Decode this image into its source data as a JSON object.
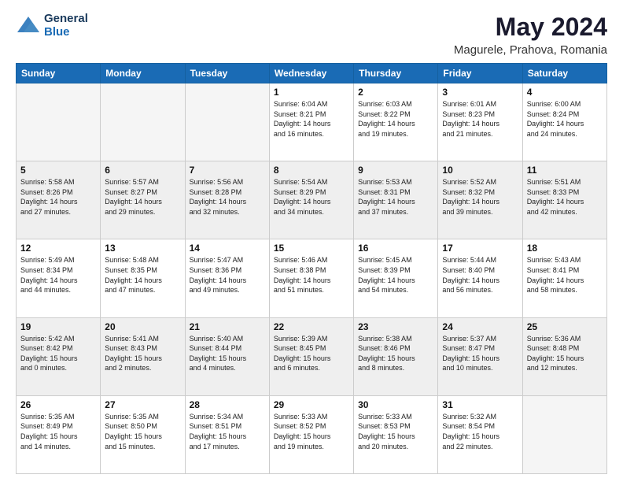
{
  "header": {
    "logo_line1": "General",
    "logo_line2": "Blue",
    "month": "May 2024",
    "location": "Magurele, Prahova, Romania"
  },
  "weekdays": [
    "Sunday",
    "Monday",
    "Tuesday",
    "Wednesday",
    "Thursday",
    "Friday",
    "Saturday"
  ],
  "weeks": [
    [
      {
        "day": "",
        "info": "",
        "empty": true
      },
      {
        "day": "",
        "info": "",
        "empty": true
      },
      {
        "day": "",
        "info": "",
        "empty": true
      },
      {
        "day": "1",
        "info": "Sunrise: 6:04 AM\nSunset: 8:21 PM\nDaylight: 14 hours\nand 16 minutes.",
        "empty": false
      },
      {
        "day": "2",
        "info": "Sunrise: 6:03 AM\nSunset: 8:22 PM\nDaylight: 14 hours\nand 19 minutes.",
        "empty": false
      },
      {
        "day": "3",
        "info": "Sunrise: 6:01 AM\nSunset: 8:23 PM\nDaylight: 14 hours\nand 21 minutes.",
        "empty": false
      },
      {
        "day": "4",
        "info": "Sunrise: 6:00 AM\nSunset: 8:24 PM\nDaylight: 14 hours\nand 24 minutes.",
        "empty": false
      }
    ],
    [
      {
        "day": "5",
        "info": "Sunrise: 5:58 AM\nSunset: 8:26 PM\nDaylight: 14 hours\nand 27 minutes.",
        "empty": false
      },
      {
        "day": "6",
        "info": "Sunrise: 5:57 AM\nSunset: 8:27 PM\nDaylight: 14 hours\nand 29 minutes.",
        "empty": false
      },
      {
        "day": "7",
        "info": "Sunrise: 5:56 AM\nSunset: 8:28 PM\nDaylight: 14 hours\nand 32 minutes.",
        "empty": false
      },
      {
        "day": "8",
        "info": "Sunrise: 5:54 AM\nSunset: 8:29 PM\nDaylight: 14 hours\nand 34 minutes.",
        "empty": false
      },
      {
        "day": "9",
        "info": "Sunrise: 5:53 AM\nSunset: 8:31 PM\nDaylight: 14 hours\nand 37 minutes.",
        "empty": false
      },
      {
        "day": "10",
        "info": "Sunrise: 5:52 AM\nSunset: 8:32 PM\nDaylight: 14 hours\nand 39 minutes.",
        "empty": false
      },
      {
        "day": "11",
        "info": "Sunrise: 5:51 AM\nSunset: 8:33 PM\nDaylight: 14 hours\nand 42 minutes.",
        "empty": false
      }
    ],
    [
      {
        "day": "12",
        "info": "Sunrise: 5:49 AM\nSunset: 8:34 PM\nDaylight: 14 hours\nand 44 minutes.",
        "empty": false
      },
      {
        "day": "13",
        "info": "Sunrise: 5:48 AM\nSunset: 8:35 PM\nDaylight: 14 hours\nand 47 minutes.",
        "empty": false
      },
      {
        "day": "14",
        "info": "Sunrise: 5:47 AM\nSunset: 8:36 PM\nDaylight: 14 hours\nand 49 minutes.",
        "empty": false
      },
      {
        "day": "15",
        "info": "Sunrise: 5:46 AM\nSunset: 8:38 PM\nDaylight: 14 hours\nand 51 minutes.",
        "empty": false
      },
      {
        "day": "16",
        "info": "Sunrise: 5:45 AM\nSunset: 8:39 PM\nDaylight: 14 hours\nand 54 minutes.",
        "empty": false
      },
      {
        "day": "17",
        "info": "Sunrise: 5:44 AM\nSunset: 8:40 PM\nDaylight: 14 hours\nand 56 minutes.",
        "empty": false
      },
      {
        "day": "18",
        "info": "Sunrise: 5:43 AM\nSunset: 8:41 PM\nDaylight: 14 hours\nand 58 minutes.",
        "empty": false
      }
    ],
    [
      {
        "day": "19",
        "info": "Sunrise: 5:42 AM\nSunset: 8:42 PM\nDaylight: 15 hours\nand 0 minutes.",
        "empty": false
      },
      {
        "day": "20",
        "info": "Sunrise: 5:41 AM\nSunset: 8:43 PM\nDaylight: 15 hours\nand 2 minutes.",
        "empty": false
      },
      {
        "day": "21",
        "info": "Sunrise: 5:40 AM\nSunset: 8:44 PM\nDaylight: 15 hours\nand 4 minutes.",
        "empty": false
      },
      {
        "day": "22",
        "info": "Sunrise: 5:39 AM\nSunset: 8:45 PM\nDaylight: 15 hours\nand 6 minutes.",
        "empty": false
      },
      {
        "day": "23",
        "info": "Sunrise: 5:38 AM\nSunset: 8:46 PM\nDaylight: 15 hours\nand 8 minutes.",
        "empty": false
      },
      {
        "day": "24",
        "info": "Sunrise: 5:37 AM\nSunset: 8:47 PM\nDaylight: 15 hours\nand 10 minutes.",
        "empty": false
      },
      {
        "day": "25",
        "info": "Sunrise: 5:36 AM\nSunset: 8:48 PM\nDaylight: 15 hours\nand 12 minutes.",
        "empty": false
      }
    ],
    [
      {
        "day": "26",
        "info": "Sunrise: 5:35 AM\nSunset: 8:49 PM\nDaylight: 15 hours\nand 14 minutes.",
        "empty": false
      },
      {
        "day": "27",
        "info": "Sunrise: 5:35 AM\nSunset: 8:50 PM\nDaylight: 15 hours\nand 15 minutes.",
        "empty": false
      },
      {
        "day": "28",
        "info": "Sunrise: 5:34 AM\nSunset: 8:51 PM\nDaylight: 15 hours\nand 17 minutes.",
        "empty": false
      },
      {
        "day": "29",
        "info": "Sunrise: 5:33 AM\nSunset: 8:52 PM\nDaylight: 15 hours\nand 19 minutes.",
        "empty": false
      },
      {
        "day": "30",
        "info": "Sunrise: 5:33 AM\nSunset: 8:53 PM\nDaylight: 15 hours\nand 20 minutes.",
        "empty": false
      },
      {
        "day": "31",
        "info": "Sunrise: 5:32 AM\nSunset: 8:54 PM\nDaylight: 15 hours\nand 22 minutes.",
        "empty": false
      },
      {
        "day": "",
        "info": "",
        "empty": true
      }
    ]
  ]
}
